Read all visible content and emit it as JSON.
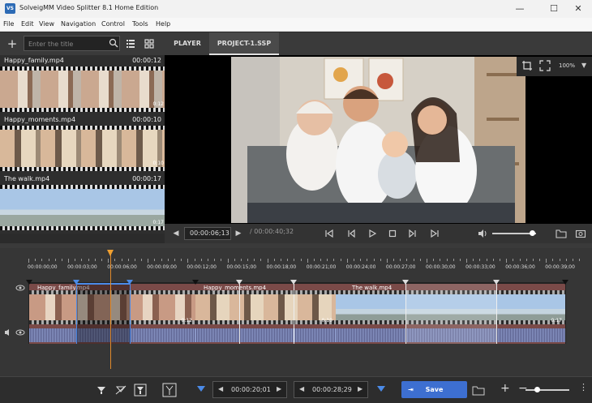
{
  "window": {
    "title": "SolveigMM Video Splitter 8.1 Home Edition",
    "logo_text": "VS",
    "minimize": "—",
    "maximize": "☐",
    "close": "✕"
  },
  "menu": [
    "File",
    "Edit",
    "View",
    "Navigation",
    "Control",
    "Tools",
    "Help"
  ],
  "toolbar": {
    "search_placeholder": "Enter the title"
  },
  "tabs": [
    "PLAYER",
    "PROJECT-1.SSP"
  ],
  "clips": [
    {
      "name": "Happy_family.mp4",
      "duration": "00:00:12",
      "end_label": "0:12"
    },
    {
      "name": "Happy_moments.mp4",
      "duration": "00:00:10",
      "end_label": "0:10"
    },
    {
      "name": "The walk.mp4",
      "duration": "00:00:17",
      "end_label": "0:17"
    }
  ],
  "player": {
    "zoom": "100%",
    "current_time": "00:00:06;13",
    "total_time": "/ 00:00:40;32",
    "volume": 0.9
  },
  "ruler": [
    "00:00:00;00",
    "00:00:03;00",
    "00:00:06;00",
    "00:00:09;00",
    "00:00:12;00",
    "00:00:15;00",
    "00:00:18;00",
    "00:00:21;00",
    "00:00:24;00",
    "00:00:27;00",
    "00:00:30;00",
    "00:00:33;00",
    "00:00:36;00",
    "00:00:39;00"
  ],
  "timeline_clips": [
    {
      "label": "Happy_family.mp4",
      "end_label": "0:12"
    },
    {
      "label": "Happy_moments.mp4",
      "end_label": "0:10"
    },
    {
      "label": "The walk.mp4",
      "end_label": "0:17"
    }
  ],
  "bottom": {
    "start_time": "00:00:20;01",
    "end_time": "00:00:28;29",
    "save_label": "Save",
    "zoom_level": 0.25
  }
}
